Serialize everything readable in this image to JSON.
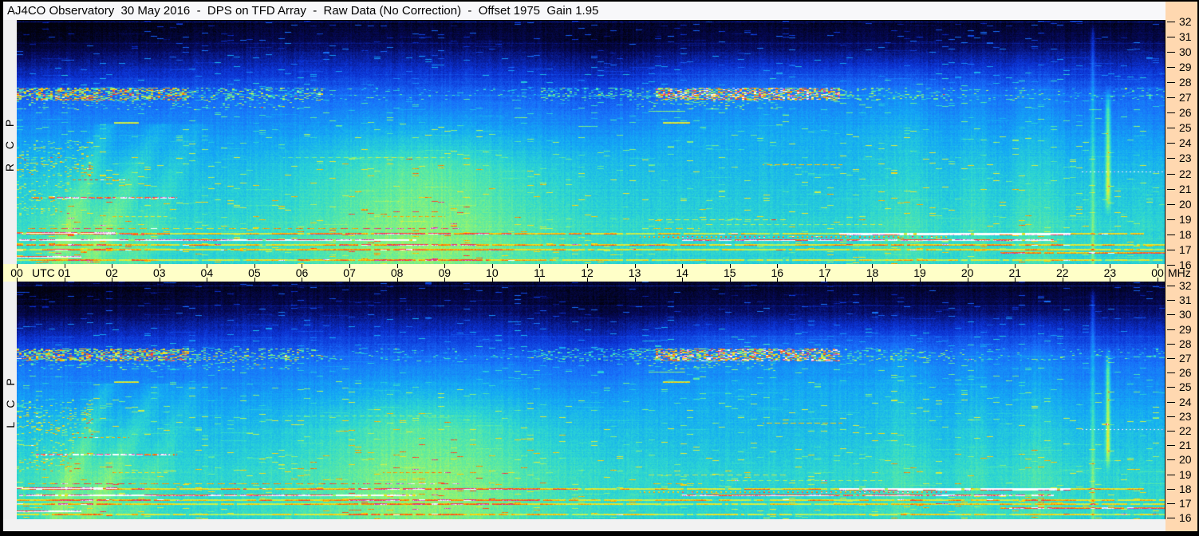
{
  "window": {
    "title": "AJ4CO Observatory  30 May 2016  -  DPS on TFD Array  -  Raw Data (No Correction)  -  Offset 1975  Gain 1.95"
  },
  "polarization_panels": [
    {
      "id": "rcp",
      "label": "R C P"
    },
    {
      "id": "lcp",
      "label": "L C P"
    }
  ],
  "time_axis": {
    "unit_label": "UTC",
    "mhz_label": "MHz",
    "hour_labels": [
      "00",
      "01",
      "02",
      "03",
      "04",
      "05",
      "06",
      "07",
      "08",
      "09",
      "10",
      "11",
      "12",
      "13",
      "14",
      "15",
      "16",
      "17",
      "18",
      "19",
      "20",
      "21",
      "22",
      "23",
      "00"
    ]
  },
  "frequency_axis": {
    "unit": "MHz",
    "tick_labels": [
      "32",
      "31",
      "30",
      "29",
      "28",
      "27",
      "26",
      "25",
      "24",
      "23",
      "22",
      "21",
      "20",
      "19",
      "18",
      "17",
      "16"
    ]
  },
  "colors": {
    "time_strip_bg": "#ffffc8",
    "freq_strip_bg": "#ffd8b0",
    "side_strip_bg": "#f0f0f0",
    "titlebar_bg": "#f8f8fa",
    "border": "#000000"
  },
  "chart_data": {
    "type": "heatmap",
    "title": "Dual-polarization radio dynamic spectrum (spectrogram), 30 May 2016",
    "x_axis": {
      "label": "UTC",
      "range_hours": [
        0,
        24
      ],
      "tick_interval_hours": 1
    },
    "y_axis": {
      "label": "MHz",
      "range_mhz": [
        16,
        32
      ],
      "tick_interval_mhz": 1
    },
    "panels": [
      {
        "name": "RCP",
        "seed": 101
      },
      {
        "name": "LCP",
        "seed": 202
      }
    ],
    "legend_position": "none",
    "grid": false,
    "notable_features": [
      "Background intensity rises from near-black at 32 MHz to cyan-green at 16 MHz",
      "Daytime background brightening below ~21 MHz centered near 08:30 UTC",
      "Speckled RFI band near 27.2 MHz, strong 00-04 UTC and 13-17 UTC",
      "Dense shortwave RFI lines between 16 and 18.5 MHz all day, with white/magenta saturated segments 17-22 UTC",
      "Magenta intermittent carrier near 20.4 MHz from 00:20 to 03:20 UTC",
      "Narrow broadband vertical event near 22.9 UTC spanning ~20-27 MHz",
      "RCP and LCP panels nearly identical"
    ],
    "colormap_stops": [
      [
        0.0,
        2,
        2,
        12
      ],
      [
        0.1,
        6,
        10,
        90
      ],
      [
        0.22,
        12,
        50,
        210
      ],
      [
        0.34,
        25,
        110,
        250
      ],
      [
        0.46,
        20,
        170,
        245
      ],
      [
        0.56,
        45,
        215,
        210
      ],
      [
        0.64,
        95,
        235,
        160
      ],
      [
        0.71,
        160,
        245,
        105
      ],
      [
        0.77,
        225,
        240,
        65
      ],
      [
        0.82,
        255,
        215,
        5
      ],
      [
        0.87,
        255,
        140,
        0
      ],
      [
        0.915,
        255,
        50,
        30
      ],
      [
        0.955,
        205,
        65,
        205
      ],
      [
        1.0,
        255,
        255,
        255
      ]
    ],
    "background_curve": [
      [
        0,
        0.045
      ],
      [
        0.08,
        0.09
      ],
      [
        0.2,
        0.22
      ],
      [
        0.3,
        0.33
      ],
      [
        0.42,
        0.4
      ],
      [
        0.55,
        0.47
      ],
      [
        0.68,
        0.52
      ],
      [
        0.8,
        0.55
      ],
      [
        0.9,
        0.565
      ],
      [
        1,
        0.55
      ]
    ],
    "time_effects": [
      {
        "name": "day-glow",
        "tc": 8.6,
        "sig": 2.4,
        "amp": 0.13,
        "trap": [
          0.3,
          0.6,
          1.0,
          1.02
        ]
      },
      {
        "name": "upper-right-brightening",
        "tc": 16.3,
        "sig": 3.6,
        "amp": 0.05,
        "trap": [
          0.12,
          0.24,
          0.44,
          0.62
        ]
      },
      {
        "name": "midday-upper-dark",
        "tc": 12.3,
        "sig": 1.4,
        "amp": -0.05,
        "trap": [
          0.0,
          0.08,
          0.34,
          0.56
        ]
      },
      {
        "name": "early-upper-dark",
        "mode": "leftdark",
        "t_end": 5.5,
        "amp": -0.055,
        "trap": [
          0.0,
          0.001,
          0.13,
          0.38
        ]
      },
      {
        "name": "vband-21.5",
        "tc": 21.45,
        "sig": 0.5,
        "amp": 0.05,
        "trap": [
          0.08,
          0.3,
          1.0,
          1.02
        ]
      },
      {
        "name": "vband-18.7",
        "tc": 18.65,
        "sig": 0.6,
        "amp": 0.045,
        "trap": [
          0.12,
          0.35,
          1.0,
          1.02
        ]
      },
      {
        "name": "vband-20.2",
        "tc": 20.15,
        "sig": 0.33,
        "amp": 0.04,
        "trap": [
          0.08,
          0.3,
          1.0,
          1.02
        ]
      },
      {
        "name": "vline-22.6",
        "tc": 22.63,
        "sig": 0.05,
        "amp": 0.11,
        "trap": [
          0.0,
          0.05,
          1.0,
          1.02
        ]
      },
      {
        "name": "vline-22.9",
        "tc": 22.95,
        "sig": 0.05,
        "amp": 0.26,
        "trap": [
          0.26,
          0.36,
          0.7,
          0.8
        ]
      },
      {
        "name": "morning-low-glow",
        "tc": 1.4,
        "sig": 1.2,
        "amp": 0.07,
        "trap": [
          0.5,
          0.8,
          1.0,
          1.02
        ]
      }
    ],
    "rays": [
      {
        "t_top": 1.9,
        "t_bottom": 0.8,
        "sig": 0.22,
        "amp": 0.07
      },
      {
        "t_top": 3.0,
        "t_bottom": 1.5,
        "sig": 0.28,
        "amp": 0.06
      },
      {
        "t_top": 3.7,
        "t_bottom": 2.5,
        "sig": 0.3,
        "amp": 0.045
      }
    ],
    "speck_bands": [
      {
        "f_range": [
          26.85,
          27.65
        ],
        "segments": [
          [
            0,
            3.6,
            0.5,
            0.5
          ],
          [
            3.6,
            6.4,
            0.22,
            0.38
          ],
          [
            6.4,
            11.0,
            0.05,
            0.25
          ],
          [
            11.0,
            13.4,
            0.2,
            0.32
          ],
          [
            13.4,
            17.3,
            0.55,
            0.55
          ],
          [
            17.3,
            19.7,
            0.15,
            0.3
          ],
          [
            19.7,
            24.2,
            0.06,
            0.28
          ]
        ]
      },
      {
        "f_range": [
          26.2,
          26.75
        ],
        "segments": [
          [
            0,
            6,
            0.08,
            0.3
          ],
          [
            13,
            16,
            0.08,
            0.3
          ]
        ]
      },
      {
        "f_range": [
          21.8,
          24.2
        ],
        "segments": [
          [
            0,
            1.6,
            0.12,
            0.28
          ]
        ]
      },
      {
        "f_range": [
          19.3,
          21.5
        ],
        "segments": [
          [
            0,
            1.2,
            0.1,
            0.22
          ]
        ]
      }
    ],
    "rfi_lines": [
      {
        "f": 32.0,
        "spans": [
          [
            0,
            24.2
          ]
        ],
        "amp": 0.1,
        "th": 1
      },
      {
        "f": 30.6,
        "spans": [
          [
            0,
            24.2
          ]
        ],
        "amp": 0.05,
        "th": 1
      },
      {
        "f": 28.55,
        "spans": [
          [
            7.5,
            24.2
          ]
        ],
        "amp": 0.04,
        "th": 1
      },
      {
        "f": 27.15,
        "spans": [
          [
            0,
            24.2
          ]
        ],
        "amp": 0.06,
        "th": 1
      },
      {
        "f": 25.35,
        "spans": [
          [
            2.05,
            2.55
          ],
          [
            13.6,
            14.15
          ]
        ],
        "amp": 0.4,
        "th": 2
      },
      {
        "f": 26.1,
        "spans": [
          [
            13.3,
            14.05
          ]
        ],
        "amp": 0.3,
        "th": 1
      },
      {
        "f": 23.05,
        "spans": [
          [
            0,
            1.1
          ],
          [
            5.6,
            9.1
          ]
        ],
        "amp": 0.13,
        "th": 1,
        "dash": [
          6,
          4
        ]
      },
      {
        "f": 22.6,
        "spans": [
          [
            15.7,
            17.35
          ]
        ],
        "amp": 0.33,
        "th": 1,
        "dash": [
          7,
          3
        ]
      },
      {
        "f": 22.15,
        "spans": [
          [
            22.35,
            24.2
          ]
        ],
        "amp": 0.5,
        "th": 1,
        "dash": [
          2,
          3
        ]
      },
      {
        "f": 21.6,
        "spans": [
          [
            1.15,
            2.35
          ]
        ],
        "amp": 0.3,
        "th": 1,
        "dash": [
          4,
          3
        ]
      },
      {
        "f": 20.4,
        "spans": [
          [
            0.3,
            3.35
          ]
        ],
        "amp": 0.42,
        "th": 2,
        "dash": [
          8,
          2
        ],
        "flick": 0.35
      },
      {
        "f": 19.2,
        "spans": [
          [
            2.0,
            3.2
          ],
          [
            7.7,
            9.0
          ]
        ],
        "amp": 0.18,
        "th": 1,
        "dash": [
          5,
          3
        ]
      },
      {
        "f": 19.0,
        "spans": [
          [
            13.3,
            16.2
          ]
        ],
        "amp": 0.2,
        "th": 1,
        "dash": [
          7,
          4
        ]
      },
      {
        "f": 18.65,
        "spans": [
          [
            14.8,
            18.2
          ]
        ],
        "amp": 0.16,
        "th": 1,
        "dash": [
          6,
          4
        ]
      },
      {
        "f": 18.4,
        "spans": [
          [
            0.2,
            9.3
          ],
          [
            13.4,
            14.4
          ]
        ],
        "amp": 0.26,
        "th": 1,
        "dash": [
          9,
          5
        ],
        "flick": 0.3
      },
      {
        "f": 18.1,
        "spans": [
          [
            0,
            2.1
          ]
        ],
        "amp": 0.4,
        "th": 2,
        "flick": 0.3
      },
      {
        "f": 18.05,
        "spans": [
          [
            0.1,
            23.7
          ]
        ],
        "amp": 0.27,
        "th": 2,
        "flick": 0.5
      },
      {
        "f": 18.05,
        "spans": [
          [
            17.3,
            22.15
          ]
        ],
        "amp": 0.5,
        "th": 3,
        "flick": 0.5
      },
      {
        "f": 17.85,
        "spans": [
          [
            13.1,
            19.6
          ]
        ],
        "amp": 0.35,
        "th": 2,
        "dash": [
          2,
          4
        ],
        "flick": 0.4
      },
      {
        "f": 17.6,
        "spans": [
          [
            0.05,
            8.4
          ],
          [
            14.0,
            21.8
          ]
        ],
        "amp": 0.44,
        "th": 2,
        "flick": 0.35
      },
      {
        "f": 17.3,
        "spans": [
          [
            0,
            24.2
          ]
        ],
        "amp": 0.27,
        "th": 2,
        "flick": 0.5
      },
      {
        "f": 17.0,
        "spans": [
          [
            0,
            24.2
          ]
        ],
        "amp": 0.24,
        "th": 2,
        "flick": 0.5
      },
      {
        "f": 16.75,
        "spans": [
          [
            20.7,
            24.2
          ]
        ],
        "amp": 0.34,
        "th": 2,
        "flick": 0.3
      },
      {
        "f": 16.5,
        "spans": [
          [
            0,
            1.35
          ]
        ],
        "amp": 0.42,
        "th": 2
      },
      {
        "f": 16.3,
        "spans": [
          [
            0,
            24.2
          ]
        ],
        "amp": 0.22,
        "th": 2,
        "flick": 0.6
      }
    ]
  }
}
